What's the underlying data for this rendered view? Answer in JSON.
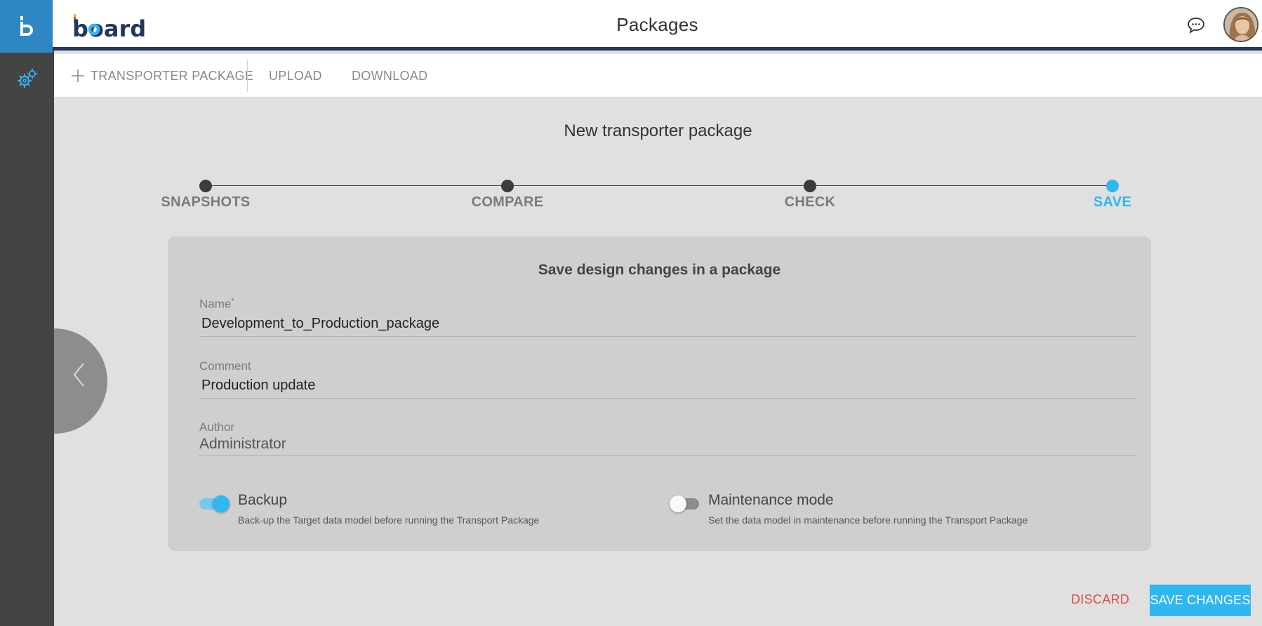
{
  "app": {
    "brand": "board",
    "page_title": "Packages"
  },
  "toolbar": {
    "new_package_label": "TRANSPORTER PACKAGE",
    "upload_label": "UPLOAD",
    "download_label": "DOWNLOAD"
  },
  "main": {
    "title": "New transporter package"
  },
  "steps": [
    {
      "label": "SNAPSHOTS",
      "state": "done"
    },
    {
      "label": "COMPARE",
      "state": "done"
    },
    {
      "label": "CHECK",
      "state": "done"
    },
    {
      "label": "SAVE",
      "state": "active"
    }
  ],
  "form": {
    "title": "Save design changes in a package",
    "name": {
      "label": "Name",
      "required_mark": "*",
      "value": "Development_to_Production_package"
    },
    "comment": {
      "label": "Comment",
      "value": "Production update"
    },
    "author": {
      "label": "Author",
      "value": "Administrator"
    },
    "backup": {
      "label": "Backup",
      "description": "Back-up the Target data model before running the Transport Package",
      "enabled": true
    },
    "maintenance": {
      "label": "Maintenance mode",
      "description": "Set the data model in maintenance before running the Transport Package",
      "enabled": false
    }
  },
  "actions": {
    "discard_label": "DISCARD",
    "save_label": "SAVE CHANGES"
  },
  "colors": {
    "accent": "#2fb7f0",
    "header_bar": "#23375f",
    "logo_tile": "#2f86c4",
    "sidebar": "#444444",
    "danger": "#e04848"
  },
  "icons": {
    "logo": "board-b-icon",
    "settings": "gears-icon",
    "chat": "chat-bubble-icon",
    "back": "chevron-left-icon",
    "add": "plus-icon"
  }
}
